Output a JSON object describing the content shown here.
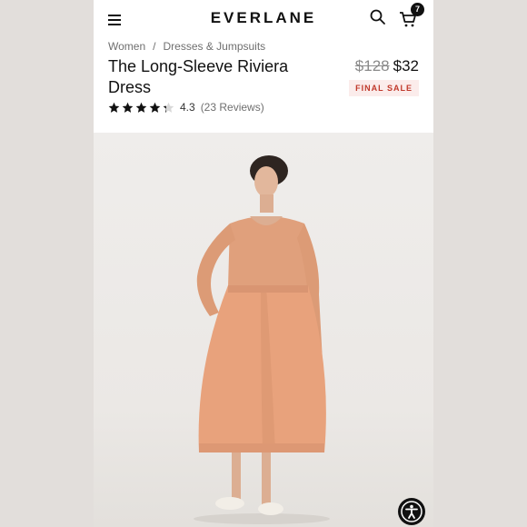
{
  "header": {
    "logo": "EVERLANE",
    "menu_icon": "hamburger-menu-icon",
    "search_icon": "search-icon",
    "cart_icon": "cart-icon",
    "cart_count": "7"
  },
  "breadcrumb": {
    "items": [
      "Women",
      "Dresses & Jumpsuits"
    ],
    "separator": "/"
  },
  "product": {
    "title": "The Long-Sleeve Riviera Dress",
    "original_price": "$128",
    "sale_price": "$32",
    "badge": "FINAL SALE",
    "rating": 4.3,
    "rating_text": "4.3",
    "reviews_text": "(23 Reviews)"
  },
  "gallery": {
    "image_subject": "model wearing peach long-sleeve midi dress",
    "dress_color": "#e8a27c"
  },
  "accessibility": {
    "icon": "accessibility-icon"
  },
  "colors": {
    "brand_text": "#111111",
    "sale_badge_bg": "#fbeceb",
    "sale_badge_text": "#c0392b"
  }
}
